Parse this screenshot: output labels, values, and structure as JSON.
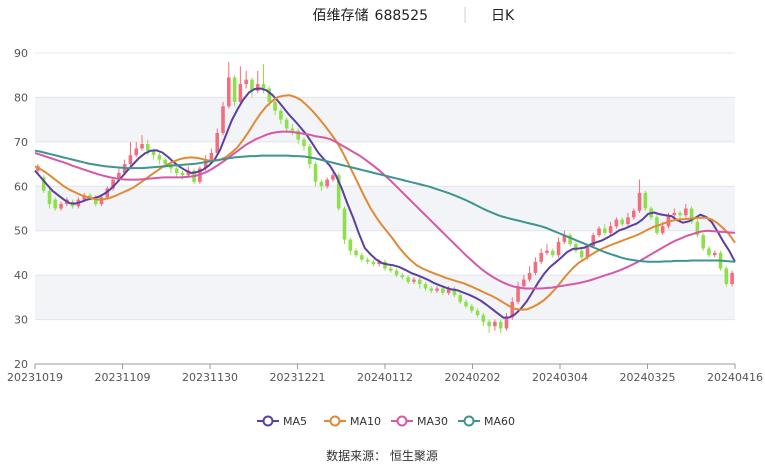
{
  "header": {
    "stock_name": "佰维存储",
    "stock_code": "688525",
    "period": "日K"
  },
  "source": "数据来源： 恒生聚源",
  "colors": {
    "up": "#f26d7d",
    "down": "#8ee04a",
    "MA5": "#5b3fa1",
    "MA10": "#e08a35",
    "MA30": "#d658a8",
    "MA60": "#3d9490",
    "band": "#f3f4f8",
    "grid": "#e2e4ec"
  },
  "chart_data": {
    "type": "candlestick",
    "ylim": [
      20,
      90
    ],
    "yticks": [
      20,
      30,
      40,
      50,
      60,
      70,
      80,
      90
    ],
    "xtick_labels": [
      "20231019",
      "20231109",
      "20231130",
      "20231221",
      "20240112",
      "20240202",
      "20240304",
      "20240325",
      "20240416"
    ],
    "xtick_positions": [
      0,
      15,
      30,
      45,
      60,
      75,
      90,
      105,
      120
    ],
    "n_days": 121,
    "candles": [
      [
        63.5,
        64.5,
        65.0,
        62.5
      ],
      [
        62.0,
        59.0,
        62.5,
        58.5
      ],
      [
        59.0,
        56.0,
        59.5,
        55.0
      ],
      [
        57.0,
        55.0,
        57.5,
        54.5
      ],
      [
        55.0,
        56.0,
        56.5,
        54.5
      ],
      [
        56.0,
        57.0,
        57.5,
        55.5
      ],
      [
        56.5,
        55.5,
        57.0,
        55.0
      ],
      [
        55.5,
        57.0,
        57.5,
        55.0
      ],
      [
        57.0,
        58.0,
        58.5,
        56.5
      ],
      [
        58.0,
        57.5,
        58.5,
        57.0
      ],
      [
        57.5,
        56.0,
        58.0,
        55.5
      ],
      [
        56.0,
        57.5,
        58.0,
        55.5
      ],
      [
        57.5,
        59.5,
        60.0,
        57.0
      ],
      [
        59.5,
        61.5,
        62.0,
        59.0
      ],
      [
        61.5,
        63.0,
        64.0,
        61.0
      ],
      [
        63.0,
        65.0,
        66.0,
        62.5
      ],
      [
        65.0,
        67.0,
        70.0,
        64.5
      ],
      [
        67.0,
        68.5,
        70.0,
        66.5
      ],
      [
        68.5,
        69.5,
        71.5,
        68.0
      ],
      [
        69.5,
        68.0,
        70.5,
        67.0
      ],
      [
        68.0,
        67.0,
        68.5,
        66.0
      ],
      [
        67.0,
        66.0,
        67.5,
        65.0
      ],
      [
        66.0,
        65.0,
        66.5,
        64.0
      ],
      [
        65.0,
        64.0,
        65.5,
        63.0
      ],
      [
        64.0,
        63.0,
        64.5,
        62.0
      ],
      [
        63.0,
        62.5,
        63.5,
        61.5
      ],
      [
        62.5,
        63.5,
        64.5,
        62.0
      ],
      [
        63.5,
        61.0,
        64.0,
        60.5
      ],
      [
        61.0,
        64.0,
        64.5,
        60.5
      ],
      [
        64.0,
        66.0,
        67.0,
        63.5
      ],
      [
        66.0,
        67.5,
        68.5,
        65.5
      ],
      [
        67.5,
        72.0,
        73.0,
        67.0
      ],
      [
        72.0,
        78.0,
        79.0,
        71.5
      ],
      [
        78.0,
        84.5,
        88.0,
        77.5
      ],
      [
        84.5,
        79.0,
        85.0,
        78.0
      ],
      [
        79.0,
        83.0,
        87.0,
        78.5
      ],
      [
        83.0,
        84.0,
        86.0,
        82.0
      ],
      [
        84.0,
        81.5,
        84.5,
        80.0
      ],
      [
        81.5,
        83.0,
        86.0,
        81.0
      ],
      [
        83.0,
        82.0,
        87.5,
        81.0
      ],
      [
        82.0,
        79.0,
        82.5,
        78.0
      ],
      [
        79.0,
        77.0,
        79.5,
        76.0
      ],
      [
        77.0,
        75.0,
        77.5,
        74.0
      ],
      [
        75.0,
        73.0,
        75.5,
        72.0
      ],
      [
        73.0,
        72.5,
        74.0,
        71.5
      ],
      [
        72.5,
        70.5,
        73.0,
        69.5
      ],
      [
        70.5,
        69.0,
        71.0,
        68.0
      ],
      [
        69.0,
        65.0,
        69.5,
        64.0
      ],
      [
        65.0,
        61.0,
        65.5,
        60.0
      ],
      [
        61.0,
        60.0,
        61.5,
        59.0
      ],
      [
        60.0,
        61.5,
        62.0,
        59.5
      ],
      [
        61.5,
        62.5,
        63.0,
        61.0
      ],
      [
        62.5,
        55.0,
        63.0,
        54.5
      ],
      [
        55.0,
        48.0,
        55.5,
        47.0
      ],
      [
        48.0,
        45.5,
        48.5,
        44.5
      ],
      [
        45.5,
        44.5,
        46.0,
        44.0
      ],
      [
        44.5,
        43.5,
        45.0,
        43.0
      ],
      [
        43.5,
        43.0,
        44.0,
        42.5
      ],
      [
        43.0,
        42.5,
        43.5,
        42.0
      ],
      [
        42.5,
        43.0,
        43.5,
        42.0
      ],
      [
        43.0,
        41.5,
        43.5,
        41.0
      ],
      [
        41.5,
        41.0,
        42.0,
        40.5
      ],
      [
        41.0,
        40.0,
        41.5,
        39.5
      ],
      [
        40.0,
        39.5,
        40.5,
        39.0
      ],
      [
        39.5,
        38.5,
        40.0,
        38.0
      ],
      [
        38.5,
        39.0,
        39.5,
        38.0
      ],
      [
        39.0,
        38.0,
        39.5,
        37.0
      ],
      [
        38.0,
        37.0,
        38.5,
        36.5
      ],
      [
        37.0,
        36.5,
        37.5,
        36.0
      ],
      [
        36.5,
        37.0,
        37.5,
        36.0
      ],
      [
        37.0,
        36.0,
        37.5,
        35.5
      ],
      [
        36.0,
        37.0,
        37.5,
        35.5
      ],
      [
        37.0,
        35.5,
        37.5,
        35.0
      ],
      [
        35.5,
        34.0,
        36.0,
        33.5
      ],
      [
        34.0,
        33.0,
        34.5,
        32.5
      ],
      [
        33.0,
        32.0,
        33.5,
        31.5
      ],
      [
        32.0,
        31.0,
        32.5,
        30.5
      ],
      [
        31.0,
        29.5,
        31.5,
        28.5
      ],
      [
        29.5,
        28.5,
        30.0,
        27.0
      ],
      [
        28.5,
        29.5,
        30.0,
        27.5
      ],
      [
        29.5,
        28.0,
        30.0,
        27.0
      ],
      [
        28.0,
        30.5,
        31.5,
        27.5
      ],
      [
        30.5,
        34.0,
        35.0,
        30.0
      ],
      [
        34.0,
        37.5,
        38.5,
        33.5
      ],
      [
        37.5,
        39.0,
        40.0,
        37.0
      ],
      [
        39.0,
        40.5,
        42.0,
        38.5
      ],
      [
        40.5,
        43.0,
        44.0,
        40.0
      ],
      [
        43.0,
        45.0,
        46.0,
        42.5
      ],
      [
        45.0,
        45.5,
        47.0,
        44.5
      ],
      [
        45.5,
        44.5,
        46.0,
        44.0
      ],
      [
        44.5,
        47.5,
        48.5,
        44.0
      ],
      [
        47.5,
        49.0,
        50.0,
        47.0
      ],
      [
        49.0,
        47.0,
        49.5,
        46.5
      ],
      [
        47.0,
        45.5,
        47.5,
        45.0
      ],
      [
        45.5,
        44.0,
        46.0,
        43.5
      ],
      [
        44.0,
        46.5,
        47.0,
        43.5
      ],
      [
        46.5,
        49.0,
        49.5,
        46.0
      ],
      [
        49.0,
        50.5,
        51.0,
        48.5
      ],
      [
        50.5,
        49.5,
        51.5,
        49.0
      ],
      [
        49.5,
        51.0,
        52.0,
        49.0
      ],
      [
        51.0,
        52.5,
        53.0,
        50.5
      ],
      [
        52.5,
        51.5,
        53.0,
        51.0
      ],
      [
        51.5,
        53.0,
        54.0,
        51.0
      ],
      [
        53.0,
        54.5,
        55.0,
        52.5
      ],
      [
        54.5,
        58.5,
        61.5,
        54.0
      ],
      [
        58.5,
        55.0,
        59.0,
        54.5
      ],
      [
        55.0,
        53.0,
        55.5,
        52.5
      ],
      [
        53.0,
        49.5,
        53.5,
        49.0
      ],
      [
        49.5,
        51.0,
        52.0,
        49.0
      ],
      [
        51.0,
        53.5,
        54.0,
        50.5
      ],
      [
        53.5,
        54.0,
        55.0,
        53.0
      ],
      [
        54.0,
        53.5,
        54.5,
        52.0
      ],
      [
        53.5,
        55.0,
        56.0,
        53.0
      ],
      [
        55.0,
        52.0,
        55.5,
        51.5
      ],
      [
        52.0,
        49.0,
        52.5,
        48.5
      ],
      [
        49.0,
        46.0,
        49.5,
        45.5
      ],
      [
        46.0,
        44.5,
        46.5,
        44.0
      ],
      [
        44.5,
        45.0,
        45.5,
        44.0
      ],
      [
        45.0,
        41.5,
        45.5,
        41.0
      ],
      [
        41.5,
        38.0,
        42.0,
        37.5
      ],
      [
        38.0,
        40.5,
        41.0,
        37.5
      ]
    ],
    "series": [
      {
        "name": "MA5",
        "values": [
          63.5,
          62.0,
          60.5,
          59.0,
          58.0,
          57.0,
          56.2,
          56.1,
          56.5,
          57.0,
          57.3,
          57.6,
          58.3,
          59.3,
          60.6,
          62.1,
          63.6,
          65.0,
          66.4,
          67.4,
          68.0,
          68.1,
          67.6,
          66.6,
          65.4,
          64.4,
          63.6,
          63.0,
          63.2,
          63.7,
          64.6,
          65.9,
          68.2,
          71.5,
          74.8,
          77.3,
          79.5,
          81.1,
          81.9,
          82.0,
          81.6,
          80.6,
          79.2,
          77.6,
          76.0,
          74.6,
          73.1,
          71.5,
          69.5,
          67.5,
          66.0,
          64.6,
          62.5,
          59.6,
          56.1,
          52.9,
          49.3,
          46.1,
          44.7,
          43.5,
          42.7,
          42.4,
          42.2,
          41.8,
          41.2,
          40.5,
          40.0,
          39.5,
          38.9,
          38.2,
          37.7,
          37.2,
          36.8,
          36.6,
          36.1,
          35.6,
          35.0,
          34.3,
          33.4,
          32.4,
          31.4,
          30.4,
          30.5,
          31.2,
          32.5,
          34.1,
          36.2,
          38.4,
          40.3,
          41.8,
          42.9,
          44.0,
          45.2,
          45.9,
          46.0,
          46.2,
          46.9,
          47.4,
          47.8,
          48.5,
          49.2,
          50.1,
          50.5,
          51.1,
          51.6,
          52.5,
          53.8,
          54.1,
          53.7,
          53.5,
          53.3,
          52.4,
          51.8,
          52.1,
          52.8,
          53.6,
          53.1,
          51.9,
          49.8,
          47.5,
          45.5,
          43.0
        ]
      },
      {
        "name": "MA10",
        "values": [
          64.5,
          63.8,
          63.0,
          62.0,
          61.0,
          60.0,
          59.2,
          58.6,
          58.0,
          57.6,
          57.2,
          57.0,
          57.1,
          57.4,
          57.9,
          58.5,
          59.1,
          59.7,
          60.6,
          61.5,
          62.5,
          63.4,
          64.3,
          65.0,
          65.6,
          66.1,
          66.4,
          66.5,
          66.4,
          66.1,
          65.8,
          65.8,
          66.0,
          66.6,
          67.6,
          68.8,
          70.5,
          72.4,
          74.5,
          76.4,
          78.0,
          79.2,
          80.1,
          80.4,
          80.5,
          80.1,
          79.4,
          78.2,
          76.9,
          75.4,
          73.8,
          72.1,
          70.3,
          68.1,
          65.5,
          62.9,
          60.2,
          57.5,
          55.1,
          53.0,
          51.2,
          49.6,
          47.9,
          46.1,
          44.6,
          43.3,
          42.2,
          41.5,
          40.9,
          40.4,
          39.9,
          39.4,
          39.0,
          38.6,
          38.2,
          37.7,
          37.1,
          36.5,
          35.9,
          35.3,
          34.6,
          33.8,
          33.0,
          32.4,
          32.2,
          32.3,
          32.8,
          33.5,
          34.4,
          35.6,
          37.0,
          38.6,
          40.2,
          41.6,
          42.8,
          43.6,
          44.5,
          45.3,
          45.9,
          46.5,
          47.0,
          47.5,
          48.0,
          48.5,
          49.0,
          49.6,
          50.3,
          50.9,
          51.3,
          51.8,
          52.2,
          52.5,
          52.6,
          52.7,
          52.8,
          52.9,
          52.9,
          52.5,
          51.7,
          50.5,
          49.2,
          47.3
        ]
      },
      {
        "name": "MA30",
        "values": [
          67.5,
          67.1,
          66.7,
          66.3,
          65.9,
          65.5,
          65.1,
          64.6,
          64.2,
          63.8,
          63.4,
          63.0,
          62.6,
          62.3,
          62.0,
          61.8,
          61.6,
          61.5,
          61.5,
          61.5,
          61.6,
          61.7,
          61.8,
          61.9,
          62.0,
          62.0,
          62.0,
          62.0,
          62.1,
          62.2,
          62.4,
          62.8,
          63.3,
          64.0,
          64.8,
          65.6,
          66.5,
          67.4,
          68.3,
          69.2,
          69.9,
          70.6,
          71.1,
          71.6,
          72.0,
          72.2,
          72.3,
          72.3,
          72.2,
          72.0,
          71.8,
          71.6,
          71.3,
          71.1,
          70.9,
          70.5,
          69.9,
          69.2,
          68.5,
          67.8,
          67.1,
          66.3,
          65.4,
          64.5,
          63.5,
          62.4,
          61.3,
          60.1,
          58.9,
          57.7,
          56.5,
          55.3,
          54.1,
          52.9,
          51.7,
          50.5,
          49.3,
          48.1,
          46.9,
          45.7,
          44.5,
          43.4,
          42.3,
          41.3,
          40.4,
          39.6,
          38.9,
          38.3,
          37.8,
          37.4,
          37.2,
          37.0,
          37.0,
          37.0,
          37.0,
          37.1,
          37.2,
          37.4,
          37.6,
          37.8,
          38.0,
          38.2,
          38.5,
          38.8,
          39.2,
          39.6,
          40.0,
          40.4,
          40.8,
          41.3,
          41.8,
          42.4,
          43.0,
          43.7,
          44.4,
          45.1,
          45.8,
          46.5,
          47.2,
          47.8,
          48.3,
          48.8,
          49.2,
          49.6,
          49.9,
          50.0,
          49.9,
          49.8,
          49.7,
          49.6,
          49.5
        ]
      },
      {
        "name": "MA60",
        "values": [
          68.0,
          67.8,
          67.5,
          67.2,
          66.9,
          66.6,
          66.3,
          66.0,
          65.7,
          65.4,
          65.1,
          64.9,
          64.7,
          64.5,
          64.4,
          64.3,
          64.2,
          64.1,
          64.1,
          64.1,
          64.1,
          64.2,
          64.3,
          64.4,
          64.5,
          64.6,
          64.7,
          64.8,
          64.9,
          65.0,
          65.1,
          65.3,
          65.5,
          65.7,
          65.9,
          66.1,
          66.3,
          66.5,
          66.6,
          66.7,
          66.8,
          66.8,
          66.9,
          66.9,
          66.9,
          66.9,
          66.9,
          66.9,
          66.8,
          66.8,
          66.7,
          66.5,
          66.3,
          66.0,
          65.7,
          65.4,
          65.1,
          64.8,
          64.5,
          64.2,
          63.9,
          63.6,
          63.3,
          63.0,
          62.7,
          62.4,
          62.1,
          61.8,
          61.5,
          61.2,
          60.9,
          60.6,
          60.3,
          60.0,
          59.6,
          59.2,
          58.8,
          58.4,
          57.9,
          57.4,
          56.9,
          56.3,
          55.7,
          55.1,
          54.5,
          54.0,
          53.5,
          53.1,
          52.8,
          52.5,
          52.2,
          51.9,
          51.6,
          51.3,
          51.0,
          50.6,
          50.1,
          49.6,
          49.1,
          48.6,
          48.1,
          47.6,
          47.1,
          46.6,
          46.1,
          45.6,
          45.1,
          44.7,
          44.3,
          43.9,
          43.6,
          43.4,
          43.2,
          43.1,
          43.0,
          43.0,
          43.0,
          43.1,
          43.1,
          43.2,
          43.2,
          43.2,
          43.3,
          43.3,
          43.3,
          43.3,
          43.3,
          43.3,
          43.2,
          43.1,
          43.0
        ]
      }
    ]
  }
}
